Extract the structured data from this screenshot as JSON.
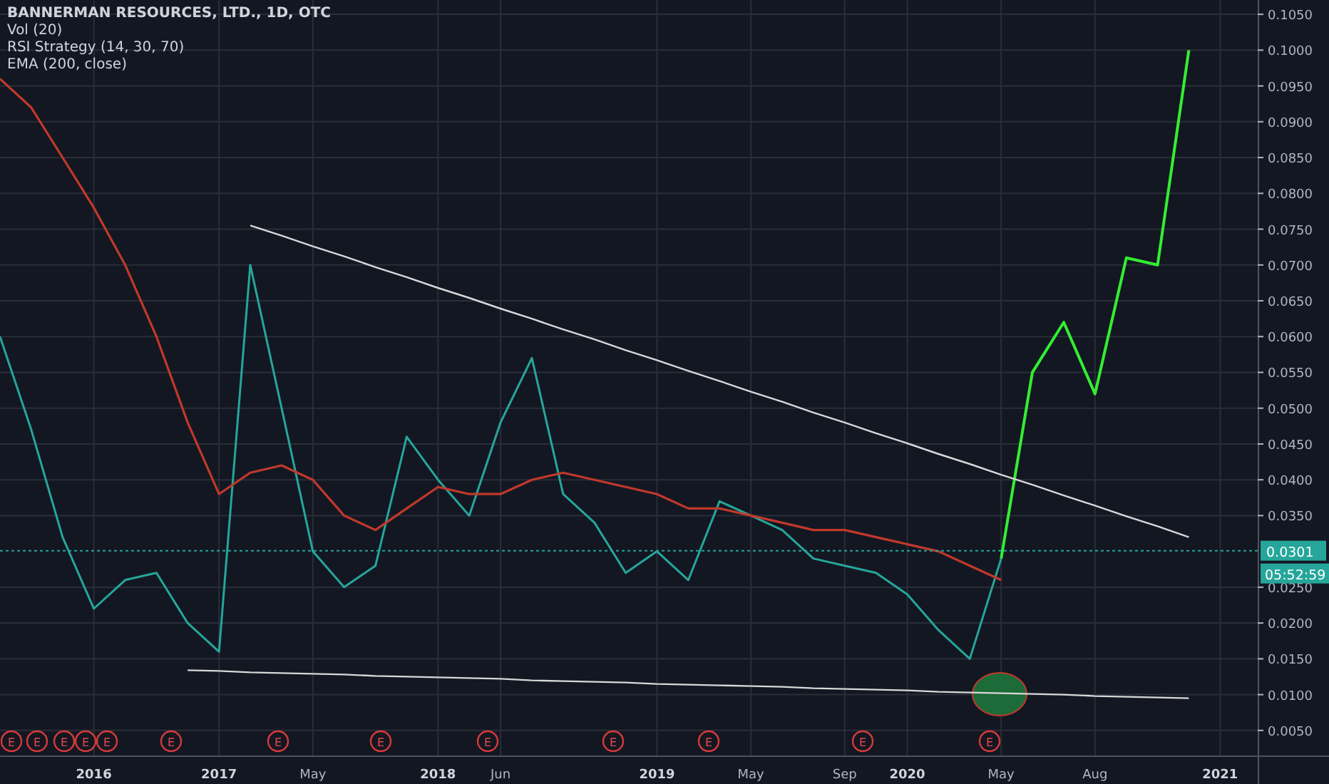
{
  "legend": {
    "title": "BANNERMAN RESOURCES, LTD., 1D, OTC",
    "studies": [
      "Vol (20)",
      "RSI Strategy (14, 30, 70)",
      "EMA (200, close)"
    ]
  },
  "chart": {
    "countdown": "05:52:59",
    "events": [
      {
        "label": "E"
      },
      {
        "label": "E"
      },
      {
        "label": "E"
      },
      {
        "label": "E"
      },
      {
        "label": "E"
      },
      {
        "label": "E"
      },
      {
        "label": "E"
      },
      {
        "label": "E"
      },
      {
        "label": "E"
      },
      {
        "label": "E"
      },
      {
        "label": "E"
      },
      {
        "label": "E"
      },
      {
        "label": "E"
      }
    ],
    "chart_data": {
      "type": "line",
      "grid": true,
      "ref_lines": [
        {
          "axis": "y",
          "value": 0.0301,
          "label": "0.0301",
          "color": "#26a69a"
        }
      ],
      "categories": [
        null,
        null,
        null,
        "2016",
        null,
        null,
        null,
        "2017",
        null,
        null,
        "May",
        null,
        null,
        null,
        "2018",
        null,
        "Jun",
        null,
        null,
        null,
        null,
        "2019",
        null,
        null,
        "May",
        null,
        null,
        "Sep",
        null,
        "2020",
        null,
        null,
        "May",
        null,
        null,
        "Aug",
        null,
        null,
        null,
        "2021"
      ],
      "ylim": [
        0.0015,
        0.107
      ],
      "yticks": [
        {
          "value": 0.005,
          "label": "0.0050"
        },
        {
          "value": 0.01,
          "label": "0.0100"
        },
        {
          "value": 0.015,
          "label": "0.0150"
        },
        {
          "value": 0.02,
          "label": "0.0200"
        },
        {
          "value": 0.025,
          "label": "0.0250"
        },
        {
          "value": 0.035,
          "label": "0.0350"
        },
        {
          "value": 0.04,
          "label": "0.0400"
        },
        {
          "value": 0.045,
          "label": "0.0450"
        },
        {
          "value": 0.05,
          "label": "0.0500"
        },
        {
          "value": 0.055,
          "label": "0.0550"
        },
        {
          "value": 0.06,
          "label": "0.0600"
        },
        {
          "value": 0.065,
          "label": "0.0650"
        },
        {
          "value": 0.07,
          "label": "0.0700"
        },
        {
          "value": 0.075,
          "label": "0.0750"
        },
        {
          "value": 0.08,
          "label": "0.0800"
        },
        {
          "value": 0.085,
          "label": "0.0850"
        },
        {
          "value": 0.09,
          "label": "0.0900"
        },
        {
          "value": 0.095,
          "label": "0.0950"
        },
        {
          "value": 0.1,
          "label": "0.1000"
        },
        {
          "value": 0.105,
          "label": "0.1050"
        }
      ],
      "series": [
        {
          "color": "#26a69a",
          "values": [
            0.06,
            0.047,
            0.032,
            0.022,
            0.026,
            0.027,
            0.02,
            0.016,
            0.07,
            0.05,
            0.03,
            0.025,
            0.028,
            0.046,
            0.04,
            0.035,
            0.048,
            0.057,
            0.038,
            0.034,
            0.027,
            0.03,
            0.026,
            0.037,
            0.035,
            0.033,
            0.029,
            0.028,
            0.027,
            0.024,
            0.019,
            0.015,
            0.029,
            null,
            null,
            null,
            null,
            null,
            null,
            null
          ]
        },
        {
          "color": "#c0392b",
          "values": [
            0.096,
            0.092,
            0.085,
            0.078,
            0.07,
            0.06,
            0.048,
            0.038,
            0.041,
            0.042,
            0.04,
            0.035,
            0.033,
            0.036,
            0.039,
            0.038,
            0.038,
            0.04,
            0.041,
            0.04,
            0.039,
            0.038,
            0.036,
            0.036,
            0.035,
            0.034,
            0.033,
            0.033,
            0.032,
            0.031,
            0.03,
            0.028,
            0.026,
            null,
            null,
            null,
            null,
            null,
            null,
            null
          ]
        },
        {
          "color": "#33ee33",
          "values": [
            null,
            null,
            null,
            null,
            null,
            null,
            null,
            null,
            null,
            null,
            null,
            null,
            null,
            null,
            null,
            null,
            null,
            null,
            null,
            null,
            null,
            null,
            null,
            null,
            null,
            null,
            null,
            null,
            null,
            null,
            null,
            null,
            0.029,
            0.055,
            0.062,
            0.052,
            0.071,
            0.07,
            0.1,
            null
          ]
        },
        {
          "color": "#d8d8d8",
          "values": [
            null,
            null,
            null,
            null,
            null,
            null,
            null,
            null,
            0.0755,
            0.0741,
            0.0726,
            0.0712,
            0.0697,
            0.0683,
            0.0668,
            0.0654,
            0.0639,
            0.0625,
            0.061,
            0.0596,
            0.0581,
            0.0567,
            0.0552,
            0.0538,
            0.0523,
            0.0509,
            0.0494,
            0.048,
            0.0465,
            0.0451,
            0.0436,
            0.0422,
            0.0407,
            0.0393,
            0.0378,
            0.0364,
            0.0349,
            0.0335,
            0.032,
            null
          ]
        },
        {
          "color": "#d8d8d8",
          "values": [
            null,
            null,
            null,
            null,
            null,
            null,
            0.0134,
            0.0133,
            0.0131,
            0.013,
            0.0129,
            0.0128,
            0.0126,
            0.0125,
            0.0124,
            0.0123,
            0.0122,
            0.012,
            0.0119,
            0.0118,
            0.0117,
            0.0115,
            0.0114,
            0.0113,
            0.0112,
            0.0111,
            0.0109,
            0.0108,
            0.0107,
            0.0106,
            0.0104,
            0.0103,
            0.0102,
            0.0101,
            0.01,
            0.0098,
            0.0097,
            0.0096,
            0.0095,
            null
          ]
        }
      ]
    }
  }
}
